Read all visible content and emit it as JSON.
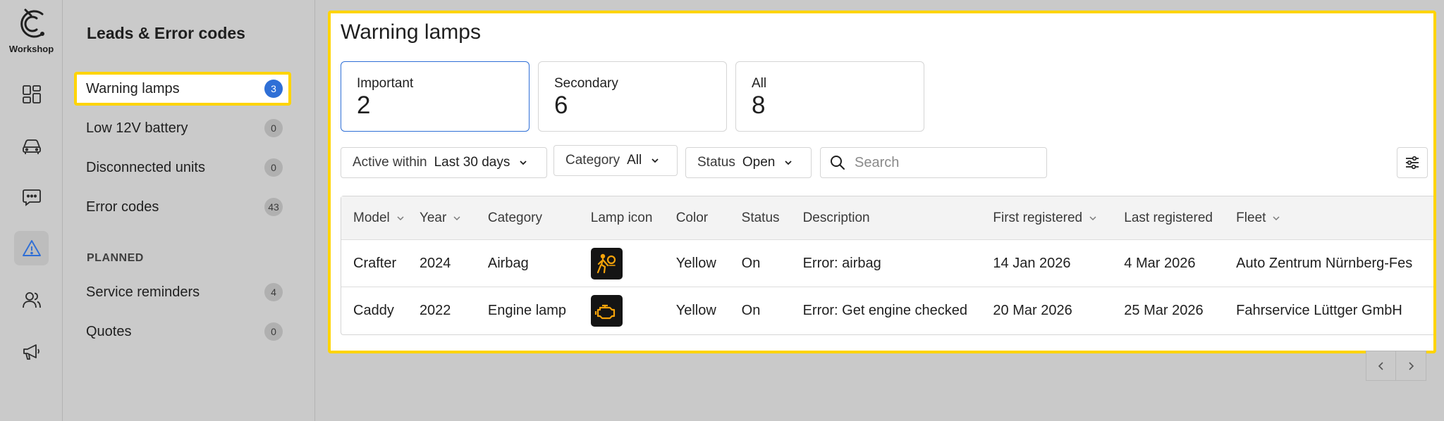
{
  "app": {
    "logo_label": "Workshop"
  },
  "rail": {
    "items": [
      {
        "icon": "dashboard-icon"
      },
      {
        "icon": "car-icon"
      },
      {
        "icon": "chat-icon"
      },
      {
        "icon": "warning-icon",
        "active": true
      },
      {
        "icon": "users-icon"
      },
      {
        "icon": "megaphone-icon"
      }
    ]
  },
  "subnav": {
    "title": "Leads & Error codes",
    "items": [
      {
        "label": "Warning lamps",
        "count": "3",
        "active": true
      },
      {
        "label": "Low 12V battery",
        "count": "0"
      },
      {
        "label": "Disconnected units",
        "count": "0"
      },
      {
        "label": "Error codes",
        "count": "43"
      }
    ],
    "section_label": "PLANNED",
    "planned_items": [
      {
        "label": "Service reminders",
        "count": "4"
      },
      {
        "label": "Quotes",
        "count": "0"
      }
    ]
  },
  "main": {
    "title": "Warning lamps",
    "stats": [
      {
        "label": "Important",
        "value": "2",
        "active": true
      },
      {
        "label": "Secondary",
        "value": "6"
      },
      {
        "label": "All",
        "value": "8"
      }
    ],
    "filters": {
      "active_within": {
        "label": "Active within",
        "value": "Last 30 days"
      },
      "category": {
        "label": "Category",
        "value": "All"
      },
      "status": {
        "label": "Status",
        "value": "Open"
      }
    },
    "search": {
      "placeholder": "Search",
      "value": ""
    },
    "table": {
      "columns": [
        "Model",
        "Year",
        "Category",
        "Lamp icon",
        "Color",
        "Status",
        "Description",
        "First registered",
        "Last registered",
        "Fleet"
      ],
      "rows": [
        {
          "model": "Crafter",
          "year": "2024",
          "category": "Airbag",
          "lamp_icon": "airbag-lamp-icon",
          "color": "Yellow",
          "status": "On",
          "description": "Error: airbag",
          "first": "14 Jan 2026",
          "last": "4 Mar 2026",
          "fleet": "Auto Zentrum Nürnberg-Fes"
        },
        {
          "model": "Caddy",
          "year": "2022",
          "category": "Engine lamp",
          "lamp_icon": "engine-lamp-icon",
          "color": "Yellow",
          "status": "On",
          "description": "Error: Get engine checked",
          "first": "20 Mar 2026",
          "last": "25 Mar 2026",
          "fleet": "Fahrservice Lüttger GmbH"
        }
      ]
    }
  },
  "colors": {
    "accent": "#2f6fd6",
    "highlight": "#ffd400",
    "lamp": "#f5a30a"
  }
}
